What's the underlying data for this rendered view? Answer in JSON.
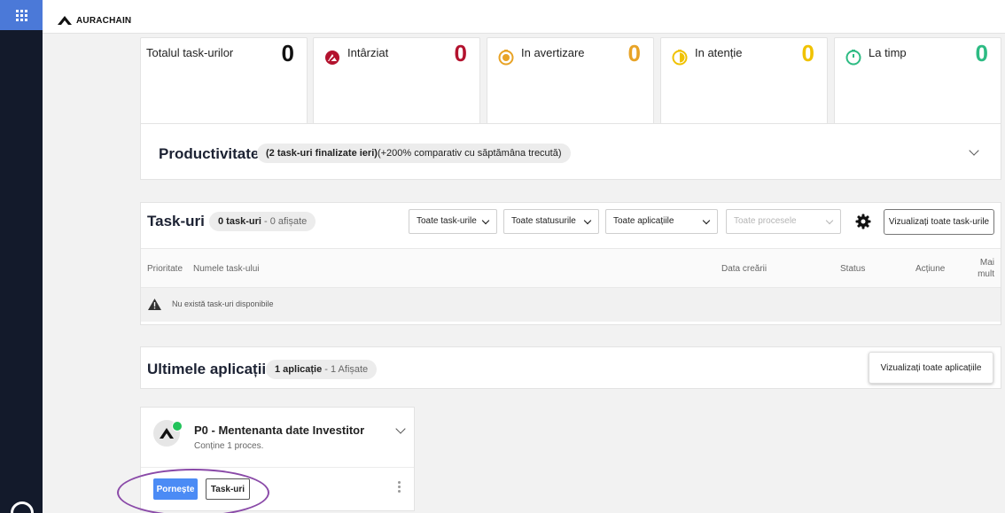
{
  "brand": {
    "name": "AURACHAIN"
  },
  "stats": [
    {
      "label": "Totalul task-urilor",
      "value": "0",
      "color": "#111111",
      "bar": "none",
      "icon": "none"
    },
    {
      "label": "Intârziat",
      "value": "0",
      "color": "#b3122e",
      "bar": "#e26d86",
      "icon": "overdue-gauge-icon"
    },
    {
      "label": "In avertizare",
      "value": "0",
      "color": "#e8a326",
      "bar": "#f0c87a",
      "icon": "warning-clock-icon"
    },
    {
      "label": "In atenție",
      "value": "0",
      "color": "#f0c200",
      "bar": "#f5de7a",
      "icon": "attention-clock-icon"
    },
    {
      "label": "La timp",
      "value": "0",
      "color": "#2dbb83",
      "bar": "#8fdcc0",
      "icon": "on-time-clock-icon"
    }
  ],
  "productivity": {
    "title": "Productivitate",
    "summary_bold": "(2 task-uri finalizate ieri)",
    "summary_rest": "(+200% comparativ cu săptămâna trecută)"
  },
  "tasks": {
    "title": "Task-uri",
    "count_bold": "0 task-uri",
    "count_rest": " - 0 afișate",
    "filters": {
      "task_filter": "Toate task-urile",
      "status_filter": "Toate statusurile",
      "app_filter": "Toate aplicațiile",
      "process_filter": "Toate procesele"
    },
    "view_all": "Vizualizați toate task-urile",
    "columns": {
      "priority": "Prioritate",
      "name": "Numele task-ului",
      "created": "Data creării",
      "status": "Status",
      "action": "Acțiune",
      "more_line1": "Mai",
      "more_line2": "mult"
    },
    "empty_message": "Nu există task-uri disponibile"
  },
  "applications": {
    "title": "Ultimele aplicații",
    "count_bold": "1 aplicație",
    "count_rest": " - 1 Afișate",
    "view_all": "Vizualizați toate aplicațiile",
    "card": {
      "name": "P0 - Mentenanta date Investitor",
      "description": "Conține 1 proces.",
      "start_label": "Pornește",
      "tasks_label": "Task-uri",
      "status_color": "#22c35a"
    }
  },
  "colors": {
    "accent": "#4b8bf5",
    "rail": "#131a2b",
    "highlight": "#8a4aa8"
  }
}
